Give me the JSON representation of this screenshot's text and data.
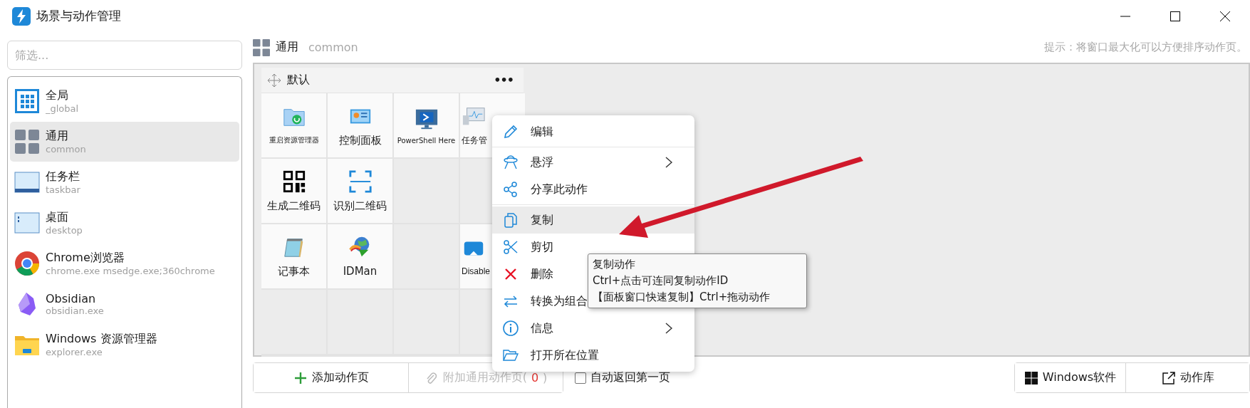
{
  "window": {
    "title": "场景与动作管理"
  },
  "filter": {
    "placeholder": "筛选..."
  },
  "sidebar": {
    "items": [
      {
        "kind": "global",
        "title": "全局",
        "subtitle": "_global",
        "selected": false
      },
      {
        "kind": "common",
        "title": "通用",
        "subtitle": "common",
        "selected": true
      },
      {
        "kind": "taskbar",
        "title": "任务栏",
        "subtitle": "taskbar",
        "selected": false
      },
      {
        "kind": "desktop",
        "title": "桌面",
        "subtitle": "desktop",
        "selected": false
      },
      {
        "kind": "chrome",
        "title": "Chrome浏览器",
        "subtitle": "chrome.exe  msedge.exe;360chrome",
        "selected": false
      },
      {
        "kind": "obsidian",
        "title": "Obsidian",
        "subtitle": "obsidian.exe",
        "selected": false
      },
      {
        "kind": "explorer",
        "title": "Windows 资源管理器",
        "subtitle": "explorer.exe",
        "selected": false
      }
    ]
  },
  "header": {
    "title": "通用",
    "subtitle": "common",
    "hint": "提示：将窗口最大化可以方便排序动作页。"
  },
  "page_group": {
    "title": "默认",
    "more": "•••",
    "cells": [
      {
        "kind": "restart",
        "label": "重启资源管理器"
      },
      {
        "kind": "panel",
        "label": "控制面板"
      },
      {
        "kind": "shell",
        "label": "PowerShell Here"
      },
      {
        "kind": "monitor",
        "label": "任务管"
      },
      {
        "kind": "qr",
        "label": "生成二维码"
      },
      {
        "kind": "scan",
        "label": "识别二维码"
      },
      {
        "kind": "empty"
      },
      {
        "kind": "empty"
      },
      {
        "kind": "notepad",
        "label": "记事本"
      },
      {
        "kind": "globe",
        "label": "IDMan"
      },
      {
        "kind": "empty"
      },
      {
        "kind": "disable",
        "label": "Disable"
      },
      {
        "kind": "empty"
      },
      {
        "kind": "empty"
      },
      {
        "kind": "empty"
      },
      {
        "kind": "empty"
      }
    ]
  },
  "context_menu": {
    "items": [
      {
        "kind": "edit",
        "label": "编辑",
        "submenu": false,
        "selected": false,
        "separator_after": true
      },
      {
        "kind": "float",
        "label": "悬浮",
        "submenu": true,
        "selected": false,
        "separator_after": false
      },
      {
        "kind": "share",
        "label": "分享此动作",
        "submenu": false,
        "selected": false,
        "separator_after": true
      },
      {
        "kind": "copy",
        "label": "复制",
        "submenu": false,
        "selected": true,
        "separator_after": false
      },
      {
        "kind": "cut",
        "label": "剪切",
        "submenu": false,
        "selected": false
      },
      {
        "kind": "delete",
        "label": "删除",
        "selected": false
      },
      {
        "kind": "convert",
        "label": "转换为组合",
        "selected": false
      },
      {
        "kind": "info",
        "label": "信息",
        "submenu": true,
        "selected": false,
        "separator_after": false
      },
      {
        "kind": "open",
        "label": "打开所在位置",
        "submenu": false,
        "selected": false,
        "separator_after": false
      }
    ]
  },
  "tooltip": {
    "lines": [
      "复制动作",
      "Ctrl+点击可连同复制动作ID",
      "【面板窗口快速复制】Ctrl+拖动动作"
    ]
  },
  "bottom_bar": {
    "add_button": "添加动作页",
    "attach_button": {
      "label": "附加通用动作页(",
      "count": "0",
      "suffix": ")",
      "disabled": true
    },
    "auto_return": {
      "label": "自动返回第一页",
      "checked": false
    },
    "windows_button": "Windows软件",
    "library_button": "动作库"
  }
}
